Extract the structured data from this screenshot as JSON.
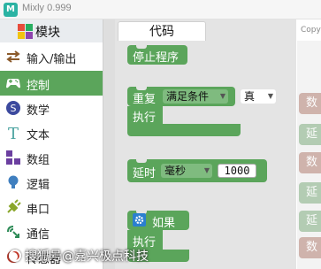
{
  "window": {
    "title": "Mixly 0.999",
    "app_icon": "M"
  },
  "sidebar": {
    "header": {
      "label": "模块",
      "icon": "puzzle-icon"
    },
    "items": [
      {
        "label": "输入/输出",
        "icon": "io-arrows-icon",
        "selected": false
      },
      {
        "label": "控制",
        "icon": "gamepad-icon",
        "selected": true
      },
      {
        "label": "数学",
        "icon": "math-icon",
        "selected": false
      },
      {
        "label": "文本",
        "icon": "text-t-icon",
        "selected": false
      },
      {
        "label": "数组",
        "icon": "array-blocks-icon",
        "selected": false
      },
      {
        "label": "逻辑",
        "icon": "bulb-icon",
        "selected": false
      },
      {
        "label": "串口",
        "icon": "plug-icon",
        "selected": false
      },
      {
        "label": "通信",
        "icon": "comm-icon",
        "selected": false
      },
      {
        "label": "传感器",
        "icon": "sensor-icon",
        "selected": false
      }
    ]
  },
  "tabs": {
    "code": "代码",
    "right": "Copy"
  },
  "blocks": {
    "stop": {
      "label": "停止程序"
    },
    "repeat": {
      "label": "重复",
      "mode": "满足条件",
      "condition": "真",
      "do": "执行"
    },
    "delay": {
      "label": "延时",
      "unit": "毫秒",
      "value": "1000"
    },
    "if": {
      "label": "如果",
      "do": "执行"
    }
  },
  "workspace_ghosts": [
    "数",
    "延",
    "数",
    "延",
    "延",
    "数",
    "数"
  ],
  "watermark": "搜狐号@嘉兴极点科技",
  "colors": {
    "block_green": "#5ba55b",
    "selected_bg": "#5ba55b",
    "gear_blue": "#2a7fd0"
  }
}
